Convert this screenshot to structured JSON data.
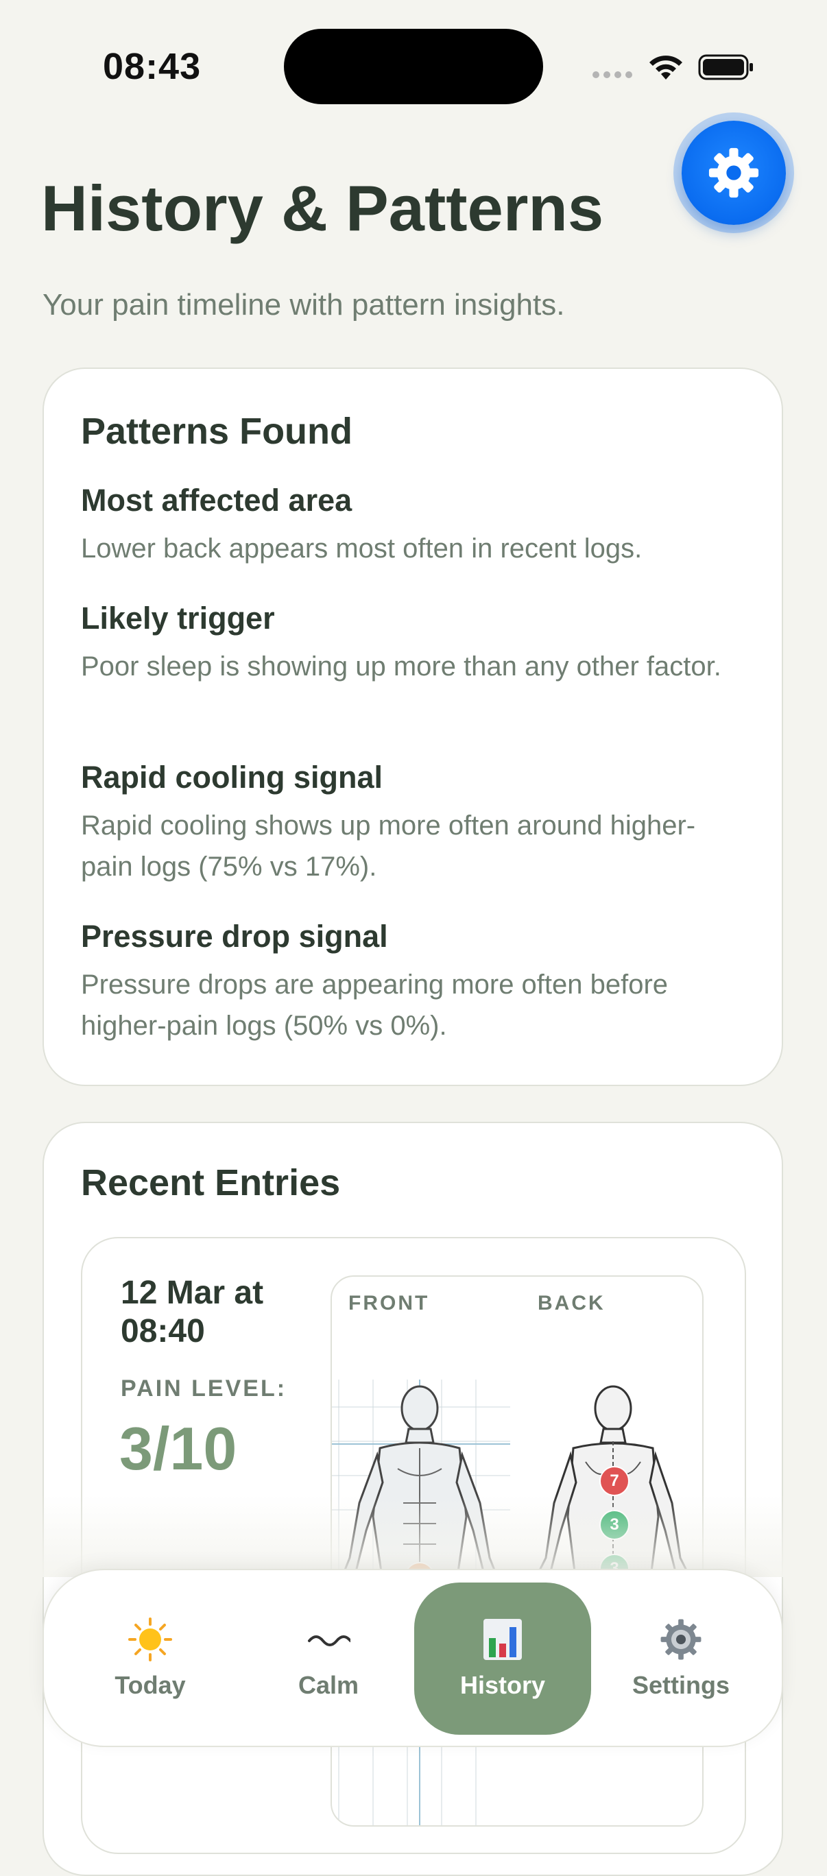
{
  "status_bar": {
    "time": "08:43"
  },
  "header": {
    "title": "History & Patterns",
    "subtitle": "Your pain timeline with pattern insights."
  },
  "patterns": {
    "title": "Patterns Found",
    "items": [
      {
        "heading": "Most affected area",
        "text": "Lower back appears most often in recent logs."
      },
      {
        "heading": "Likely trigger",
        "text": "Poor sleep is showing up more than any other factor."
      },
      {
        "heading": "Rapid cooling signal",
        "text": "Rapid cooling shows up more often around higher-pain logs (75% vs 17%)."
      },
      {
        "heading": "Pressure drop signal",
        "text": "Pressure drops are appearing more often before higher-pain logs (50% vs 0%)."
      }
    ]
  },
  "recent": {
    "title": "Recent Entries",
    "entries": [
      {
        "date": "12 Mar at 08:40",
        "pain_label": "PAIN LEVEL:",
        "pain_value": "3/10",
        "front_label": "FRONT",
        "back_label": "BACK",
        "markers": [
          {
            "view": "back",
            "value": "7",
            "color": "#e05353"
          },
          {
            "view": "back",
            "value": "3",
            "color": "#3cb371"
          },
          {
            "view": "back",
            "value": "3",
            "color": "#3cb371"
          },
          {
            "view": "front",
            "value": "5",
            "color": "#ee8a3a"
          }
        ]
      }
    ]
  },
  "tabs": [
    {
      "label": "Today",
      "icon": "sun-icon"
    },
    {
      "label": "Calm",
      "icon": "wave-icon"
    },
    {
      "label": "History",
      "icon": "bar-chart-icon",
      "active": true
    },
    {
      "label": "Settings",
      "icon": "gear-icon"
    }
  ],
  "colors": {
    "accent": "#7c9a79",
    "fab": "#0a6cf0",
    "text": "#2d3a30",
    "muted": "#6f7d71"
  }
}
